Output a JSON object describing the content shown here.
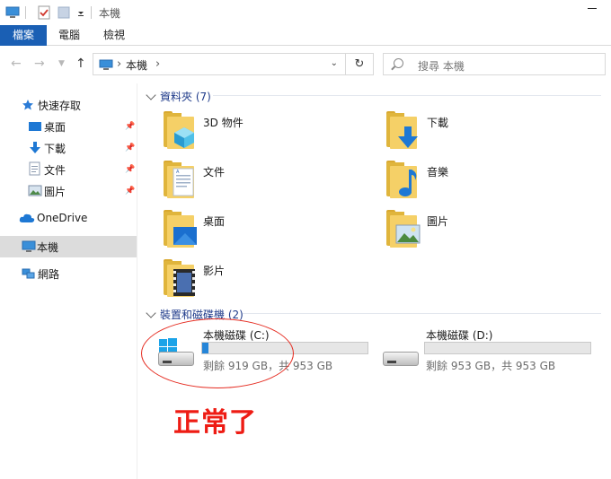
{
  "window": {
    "title": "本機"
  },
  "ribbon": {
    "tabs": [
      "檔案",
      "電腦",
      "檢視"
    ]
  },
  "address": {
    "crumbs": [
      "本機"
    ],
    "refresh_icon": "refresh-icon"
  },
  "search": {
    "placeholder": "搜尋 本機"
  },
  "sidebar": {
    "items": [
      {
        "label": "快速存取"
      },
      {
        "label": "桌面"
      },
      {
        "label": "下載"
      },
      {
        "label": "文件"
      },
      {
        "label": "圖片"
      },
      {
        "label": "OneDrive"
      },
      {
        "label": "本機"
      },
      {
        "label": "網路"
      }
    ]
  },
  "folders_group": {
    "label": "資料夾 (7)"
  },
  "folders": [
    {
      "name": "3D 物件"
    },
    {
      "name": "下載"
    },
    {
      "name": "文件"
    },
    {
      "name": "音樂"
    },
    {
      "name": "桌面"
    },
    {
      "name": "圖片"
    },
    {
      "name": "影片"
    }
  ],
  "drives_group": {
    "label": "裝置和磁碟機 (2)"
  },
  "drives": [
    {
      "name": "本機磁碟 (C:)",
      "free": "剩餘 919 GB，共 953 GB",
      "used_fraction": 0.036
    },
    {
      "name": "本機磁碟 (D:)",
      "free": "剩餘 953 GB，共 953 GB",
      "used_fraction": 0.0
    }
  ],
  "annotation": {
    "text": "正常了"
  },
  "colors": {
    "accent": "#1a5fb4",
    "annotation": "#ee1c14",
    "drive_fill": "#2585d8"
  }
}
